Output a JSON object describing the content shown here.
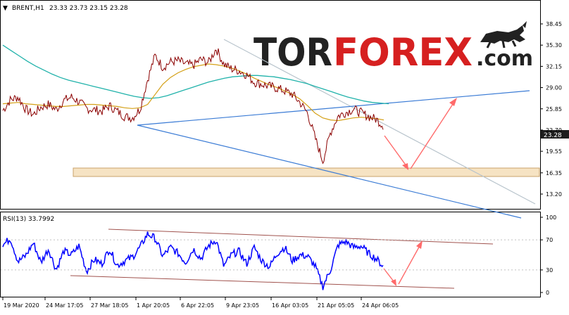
{
  "header": {
    "menu_arrow": "▼",
    "symbol_label": "BRENT,H1",
    "ohlc_text": "23.33 23.73 23.15 23.28"
  },
  "watermark": {
    "brand_part1": "TOR",
    "brand_part2": "FOREX",
    "brand_part3": ".com",
    "logo_icon": "bull-icon"
  },
  "colors": {
    "price_line": "#8b0000",
    "ma_fast": "#d4a017",
    "ma_slow": "#20b2aa",
    "trendline_blue": "#3a7bd5",
    "trendline_gray": "#b8c4cc",
    "arrow": "#ff6a6a",
    "support_zone": "#f6e3c3",
    "rsi_line": "#0000ff",
    "rsi_channel": "#a0524d",
    "current_price_badge": "#1e1e1e"
  },
  "chart_data": [
    {
      "type": "line",
      "title": "BRENT,H1",
      "ohlc": {
        "open": 23.33,
        "high": 23.73,
        "low": 23.15,
        "close": 23.28
      },
      "y_ticks": [
        38.45,
        35.3,
        32.15,
        29.0,
        25.85,
        22.7,
        19.55,
        16.35,
        13.2
      ],
      "current_price_label": "23.28",
      "ylim": [
        13.2,
        38.45
      ],
      "x_ticks": [
        "19 Mar 2020",
        "24 Mar 17:05",
        "27 Mar 18:05",
        "1 Apr 20:05",
        "6 Apr 22:05",
        "9 Apr 23:05",
        "16 Apr 03:05",
        "21 Apr 05:05",
        "24 Apr 06:05"
      ],
      "series": [
        {
          "values": [
            25.6,
            27.2,
            27.6,
            25.8,
            25.0,
            26.1,
            26.5,
            25.7,
            27.1,
            27.6,
            26.9,
            25.9,
            25.7,
            25.5,
            26.3,
            25.5,
            24.7,
            24.5,
            25.8,
            30.2,
            33.8,
            32.0,
            32.8,
            33.0,
            32.5,
            32.3,
            33.2,
            32.7,
            34.8,
            32.5,
            31.8,
            31.5,
            30.9,
            29.8,
            29.5,
            29.2,
            28.9,
            28.5,
            28.0,
            26.8,
            25.2,
            21.5,
            18.1,
            22.3,
            24.8,
            25.3,
            25.8,
            25.3,
            24.7,
            24.3,
            23.28
          ]
        },
        {
          "values": [
            26.6,
            26.7,
            26.8,
            26.6,
            26.5,
            26.4,
            26.3,
            26.2,
            26.2,
            26.3,
            26.4,
            26.5,
            26.5,
            26.4,
            26.3,
            26.2,
            26.0,
            25.9,
            26.0,
            26.5,
            28.0,
            29.5,
            30.5,
            31.2,
            31.7,
            32.1,
            32.3,
            32.5,
            32.4,
            32.2,
            31.9,
            31.5,
            31.0,
            30.4,
            29.9,
            29.4,
            29.0,
            28.5,
            28.0,
            27.3,
            26.3,
            25.2,
            24.5,
            24.2,
            24.1,
            24.3,
            24.5,
            24.6,
            24.5,
            24.4,
            24.2
          ]
        },
        {
          "values": [
            35.3,
            34.5,
            33.7,
            32.9,
            32.2,
            31.6,
            31.0,
            30.5,
            30.1,
            29.8,
            29.5,
            29.2,
            28.9,
            28.6,
            28.3,
            28.0,
            27.7,
            27.5,
            27.4,
            27.5,
            27.8,
            28.2,
            28.6,
            29.0,
            29.4,
            29.8,
            30.1,
            30.4,
            30.6,
            30.7,
            30.8,
            30.8,
            30.7,
            30.6,
            30.4,
            30.2,
            29.9,
            29.6,
            29.2,
            28.8,
            28.4,
            28.0,
            27.6,
            27.3,
            27.0,
            26.8,
            26.7,
            26.6
          ]
        }
      ]
    },
    {
      "type": "line",
      "title": "RSI(13) 33.7992",
      "y_ticks": [
        100,
        70,
        30,
        0
      ],
      "ylim": [
        0,
        100
      ],
      "series": [
        {
          "values": [
            63,
            72,
            41,
            49,
            66,
            40,
            58,
            30,
            55,
            50,
            62,
            28,
            44,
            38,
            58,
            36,
            42,
            47,
            60,
            78,
            72,
            48,
            60,
            52,
            40,
            58,
            45,
            62,
            70,
            35,
            50,
            55,
            38,
            60,
            42,
            34,
            52,
            60,
            42,
            50,
            48,
            35,
            8,
            30,
            63,
            68,
            60,
            62,
            52,
            45,
            34
          ]
        }
      ]
    }
  ]
}
